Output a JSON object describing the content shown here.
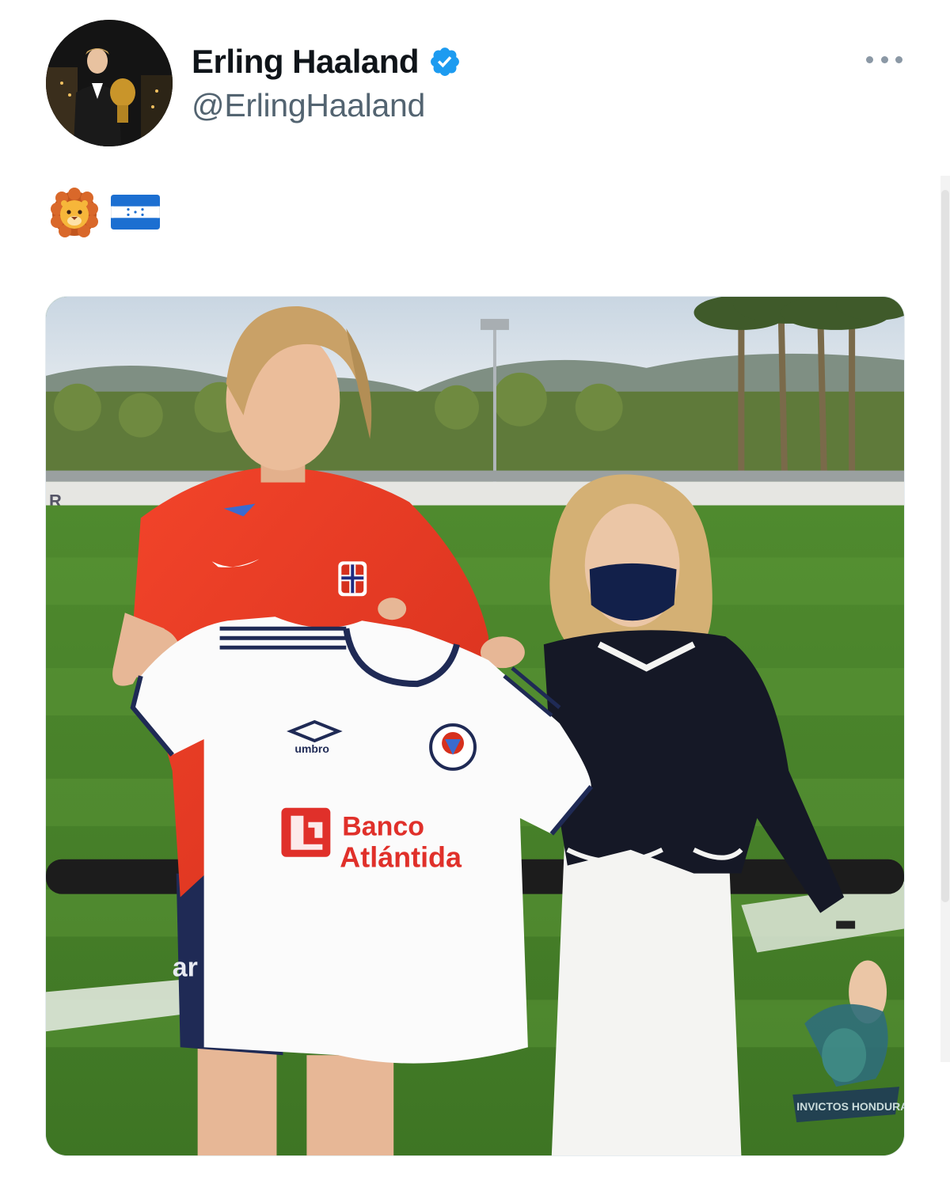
{
  "tweet": {
    "author": {
      "display_name": "Erling Haaland",
      "handle": "@ErlingHaaland",
      "verified": true,
      "verified_color": "#1d9bf0"
    },
    "text_emojis": [
      "lion-face",
      "flag-honduras"
    ],
    "media": {
      "jersey_brand": "umbro",
      "jersey_sponsor_line1": "Banco",
      "jersey_sponsor_line2": "Atlántida",
      "watermark": "INVICTOS HONDURAS",
      "sign_letter": "R",
      "shorts_text": "ar"
    }
  },
  "colors": {
    "text_primary": "#0f1419",
    "text_secondary": "#536471",
    "sponsor_red": "#e0302a"
  }
}
